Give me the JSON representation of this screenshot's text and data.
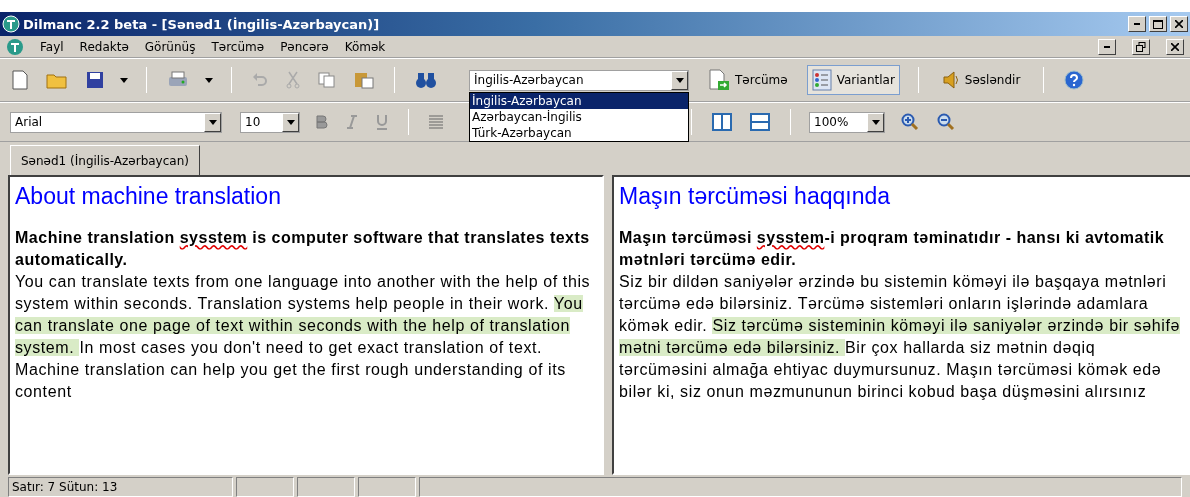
{
  "window": {
    "title": "Dilmanc 2.2 beta - [Sənəd1 (İngilis-Azərbaycan)]"
  },
  "menu": [
    "Fayl",
    "Redaktə",
    "Görünüş",
    "Tərcümə",
    "Pəncərə",
    "Kömək"
  ],
  "toolbar": {
    "language": "İngilis-Azərbaycan",
    "language_options": [
      {
        "label": "İngilis-Azərbaycan",
        "selected": true
      },
      {
        "label": "Azərbaycan-İngilis",
        "selected": false
      },
      {
        "label": "Türk-Azərbaycan",
        "selected": false
      }
    ],
    "buttons": [
      {
        "label": "Tərcümə",
        "kind": "translate",
        "selected": false
      },
      {
        "label": "Variantlar",
        "kind": "variants",
        "selected": true
      },
      {
        "label": "Səsləndir",
        "kind": "speak",
        "selected": false
      }
    ]
  },
  "format_bar": {
    "font": "Arial",
    "size": "10",
    "zoom": "100%"
  },
  "tabs": [
    {
      "label": "Sənəd1 (İngilis-Azərbaycan)",
      "selected": true
    }
  ],
  "panes": [
    {
      "heading": "About machine translation",
      "lead": [
        {
          "text": "Machine translation ",
          "misspelled": false
        },
        {
          "text": "sysstem",
          "misspelled": true
        },
        {
          "text": " is computer software that translates texts automatically.",
          "misspelled": false
        }
      ],
      "body": [
        {
          "text": "You can translate texts from one language into another with the help of this system within seconds. Translation systems help people in their work. ",
          "highlighted": false
        },
        {
          "text": "You can translate one page of text within  seconds with the help of translation system. ",
          "highlighted": true
        },
        {
          "text": "In most cases you don't need to get exact translation of text. Machine translation can help you get the first rough understanding of its content",
          "highlighted": false
        }
      ]
    },
    {
      "heading": "Maşın tərcüməsi haqqında",
      "lead": [
        {
          "text": "Maşın tərcüməsi ",
          "misspelled": false
        },
        {
          "text": "sysstem",
          "misspelled": true
        },
        {
          "text": "-i proqram təminatıdır - hansı ki avtomatik mətnləri tərcümə edir.",
          "misspelled": false
        }
      ],
      "body": [
        {
          "text": "Siz bir dildən saniyələr ərzində bu sistemin köməyi ilə başqaya mətnləri tərcümə edə bilərsiniz. Tərcümə sistemləri onların işlərində adamlara kömək edir. ",
          "highlighted": false
        },
        {
          "text": "Siz tərcümə sisteminin köməyi ilə saniyələr ərzində bir səhifə mətni tərcümə edə bilərsiniz. ",
          "highlighted": true
        },
        {
          "text": "Bir çox hallarda siz mətnin dəqiq tərcüməsini almağa ehtiyac duymursunuz. Maşın tərcüməsi kömək edə bilər ki, siz onun məzmununun birinci kobud başa düşməsini alırsınız",
          "highlighted": false
        }
      ]
    }
  ],
  "status_bar": [
    "Satır: 7 Sütun: 13"
  ]
}
